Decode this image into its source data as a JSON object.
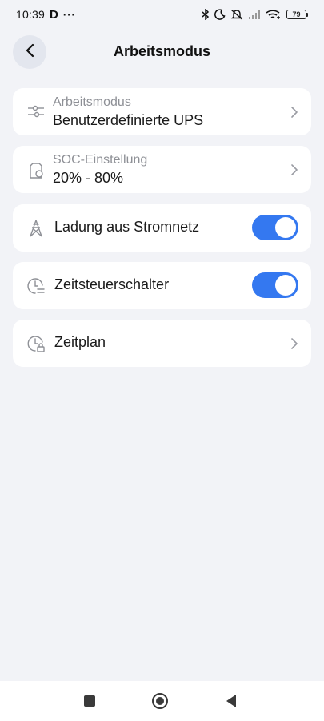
{
  "status_bar": {
    "time": "10:39",
    "app_letter": "D",
    "more": "···",
    "battery_level": "79"
  },
  "header": {
    "title": "Arbeitsmodus"
  },
  "items": [
    {
      "label": "Arbeitsmodus",
      "value": "Benutzerdefinierte UPS",
      "icon": "sliders-icon"
    },
    {
      "label": "SOC-Einstellung",
      "value": "20% - 80%",
      "icon": "battery-outline-icon"
    },
    {
      "label": "Ladung aus Stromnetz",
      "toggle_on": true,
      "icon": "power-tower-icon"
    },
    {
      "label": "Zeitsteuerschalter",
      "toggle_on": true,
      "icon": "clock-switch-icon"
    },
    {
      "label": "Zeitplan",
      "icon": "clock-lock-icon"
    }
  ],
  "colors": {
    "background": "#f2f3f7",
    "card": "#ffffff",
    "accent": "#3478f0",
    "secondary_text": "#8e9096"
  }
}
